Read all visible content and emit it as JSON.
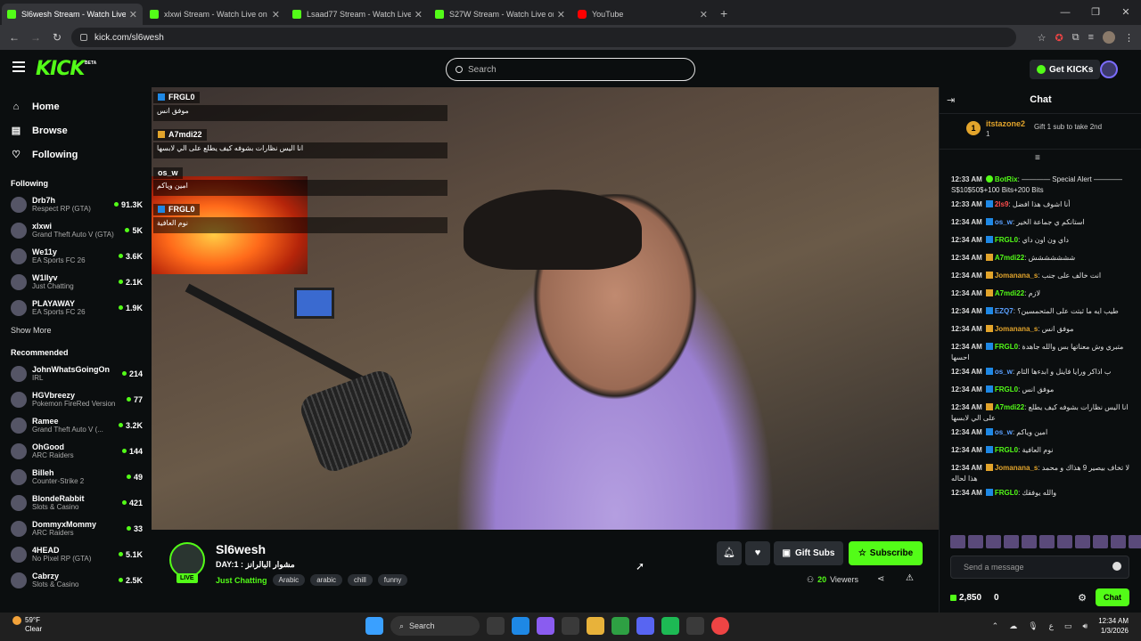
{
  "browser": {
    "tabs": [
      {
        "title": "Sl6wesh Stream - Watch Live on Kick",
        "active": true
      },
      {
        "title": "xlxwi Stream - Watch Live on Kick",
        "active": false
      },
      {
        "title": "Lsaad77 Stream - Watch Live on Kick",
        "active": false
      },
      {
        "title": "S27W Stream - Watch Live on Kick",
        "active": false
      },
      {
        "title": "YouTube",
        "active": false
      }
    ],
    "url": "kick.com/sl6wesh"
  },
  "site": {
    "logo": "KICK",
    "beta": "BETA",
    "search_placeholder": "Search",
    "get_kicks": "Get KICKs"
  },
  "sidebar": {
    "nav": [
      {
        "label": "Home",
        "icon": "home-icon"
      },
      {
        "label": "Browse",
        "icon": "browse-icon"
      },
      {
        "label": "Following",
        "icon": "heart-icon"
      }
    ],
    "following_title": "Following",
    "following": [
      {
        "name": "Drb7h",
        "category": "Respect RP (GTA)",
        "viewers": "91.3K"
      },
      {
        "name": "xlxwi",
        "category": "Grand Theft Auto V (GTA)",
        "viewers": "5K"
      },
      {
        "name": "We11y",
        "category": "EA Sports FC 26",
        "viewers": "3.6K"
      },
      {
        "name": "W1llyv",
        "category": "Just Chatting",
        "viewers": "2.1K"
      },
      {
        "name": "PLAYAWAY",
        "category": "EA Sports FC 26",
        "viewers": "1.9K"
      }
    ],
    "show_more": "Show More",
    "recommended_title": "Recommended",
    "recommended": [
      {
        "name": "JohnWhatsGoingOn",
        "category": "IRL",
        "viewers": "214"
      },
      {
        "name": "HGVbreezy",
        "category": "Pokemon FireRed Version",
        "viewers": "77"
      },
      {
        "name": "Ramee",
        "category": "Grand Theft Auto V (...",
        "viewers": "3.2K"
      },
      {
        "name": "OhGood",
        "category": "ARC Raiders",
        "viewers": "144"
      },
      {
        "name": "Billeh",
        "category": "Counter-Strike 2",
        "viewers": "49"
      },
      {
        "name": "BlondeRabbit",
        "category": "Slots & Casino",
        "viewers": "421"
      },
      {
        "name": "DommyxMommy",
        "category": "ARC Raiders",
        "viewers": "33"
      },
      {
        "name": "4HEAD",
        "category": "No Pixel RP (GTA)",
        "viewers": "5.1K"
      },
      {
        "name": "Cabrzy",
        "category": "Slots & Casino",
        "viewers": "2.5K"
      }
    ]
  },
  "overlay_chat": [
    {
      "user": "FRGL0",
      "text": "موفق انس",
      "badge": "blue"
    },
    {
      "user": "A7mdi22",
      "text": "انا اليس نظارات بشوفه كيف يطلع على الي لابسها",
      "badge": "crown"
    },
    {
      "user": "os_w",
      "text": "امين وياكم",
      "badge": "none"
    },
    {
      "user": "FRGL0",
      "text": "نوم العافية",
      "badge": "blue"
    }
  ],
  "stream": {
    "streamer": "Sl6wesh",
    "live": "LIVE",
    "title": "DAY:1 : مشوار البالرانز",
    "category": "Just Chatting",
    "tags": [
      "Arabic",
      "arabic",
      "chill",
      "funny"
    ],
    "gift_subs": "Gift Subs",
    "subscribe": "Subscribe",
    "viewers_count": "20",
    "viewers_label": "Viewers"
  },
  "chat": {
    "title": "Chat",
    "pinned": {
      "rank": "1",
      "user": "itstazone2",
      "count": "1",
      "gift": "Gift 1 sub to take 2nd"
    },
    "messages": [
      {
        "time": "12:33 AM",
        "user": "BotRix",
        "color": "#53fc18",
        "badge": "green",
        "text": "———— Special Alert ————S$10$50$+100 Bits+200 Bits"
      },
      {
        "time": "12:33 AM",
        "user": "2ls9",
        "color": "#ff4d4d",
        "badge": "blue",
        "text": "أنا اشوف هذا افضل"
      },
      {
        "time": "12:34 AM",
        "user": "os_w",
        "color": "#5aa0ff",
        "badge": "blue",
        "text": "استانكم ي جماعة الخير"
      },
      {
        "time": "12:34 AM",
        "user": "FRGL0",
        "color": "#53fc18",
        "badge": "blue",
        "text": "داي ون اون داي"
      },
      {
        "time": "12:34 AM",
        "user": "A7mdi22",
        "color": "#53fc18",
        "badge": "crown",
        "text": "ششششششش"
      },
      {
        "time": "12:34 AM",
        "user": "Jomanana_s",
        "color": "#e2a42b",
        "badge": "crown",
        "text": "انت خالف على جنب"
      },
      {
        "time": "12:34 AM",
        "user": "A7mdi22",
        "color": "#53fc18",
        "badge": "crown",
        "text": "لازم"
      },
      {
        "time": "12:34 AM",
        "user": "EZQ7",
        "color": "#5aa0ff",
        "badge": "blue",
        "text": "طيب ايه ما ثبتت على المتحمسين؟"
      },
      {
        "time": "12:34 AM",
        "user": "Jomanana_s",
        "color": "#e2a42b",
        "badge": "crown",
        "text": "موفق انس"
      },
      {
        "time": "12:34 AM",
        "user": "FRGL0",
        "color": "#53fc18",
        "badge": "blue",
        "text": "متبري وش معناتها بس والله جاهدة احسها"
      },
      {
        "time": "12:34 AM",
        "user": "os_w",
        "color": "#5aa0ff",
        "badge": "blue",
        "text": "ب اذاكر ورايا فاينل و ابدءها الثام"
      },
      {
        "time": "12:34 AM",
        "user": "FRGL0",
        "color": "#53fc18",
        "badge": "blue",
        "text": "موفق انس"
      },
      {
        "time": "12:34 AM",
        "user": "A7mdi22",
        "color": "#53fc18",
        "badge": "crown",
        "text": "انا اليس نظارات بشوفه كيف يطلع على الي لابسها"
      },
      {
        "time": "12:34 AM",
        "user": "os_w",
        "color": "#5aa0ff",
        "badge": "blue",
        "text": "امين وياكم"
      },
      {
        "time": "12:34 AM",
        "user": "FRGL0",
        "color": "#53fc18",
        "badge": "blue",
        "text": "نوم العافية"
      },
      {
        "time": "12:34 AM",
        "user": "Jomanana_s",
        "color": "#e2a42b",
        "badge": "crown",
        "text": "لا تخاف بيصير 9 هذاك و محمد هذا لحاله"
      },
      {
        "time": "12:34 AM",
        "user": "FRGL0",
        "color": "#53fc18",
        "badge": "blue",
        "text": "والله يوفقك"
      }
    ],
    "send_placeholder": "Send a message",
    "kicks": "2,850",
    "count": "0",
    "chat_button": "Chat"
  },
  "taskbar": {
    "temp": "59°F",
    "condition": "Clear",
    "search": "Search",
    "time": "12:34 AM",
    "date": "1/3/2026"
  }
}
